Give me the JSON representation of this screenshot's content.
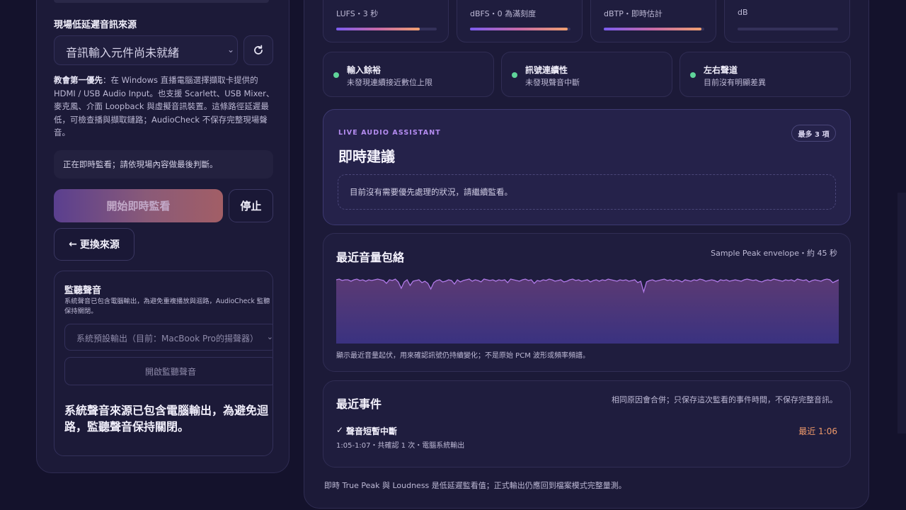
{
  "left": {
    "source_section_title": "現場低延遲音訊來源",
    "source_select_value": "音訊輸入元件尚未就緒",
    "help_bold": "教會第一優先",
    "help_rest": "：在 Windows 直播電腦選擇擷取卡提供的 HDMI / USB Audio Input。也支援 Scarlett、USB Mixer、麥克風、介面 Loopback 與虛擬音訊裝置。這條路徑延遲最低，可檢查播與擷取鏈路；AudioCheck 不保存完整現場聲音。",
    "status_note": "正在即時監看；請依現場內容做最後判斷。",
    "start_button": "開始即時監看",
    "stop_button": "停止",
    "change_source_arrow": "←",
    "change_source_button": "更換來源",
    "monitor": {
      "title": "監聽聲音",
      "description": "系統聲音已包含電腦輸出，為避免重複播放與迴路，AudioCheck 監聽保持關閉。",
      "output_select": "系統預設輸出（目前：MacBook Pro的揚聲器）",
      "open_button": "開啟監聽聲音",
      "note": "系統聲音來源已包含電腦輸出，為避免迴路，監聽聲音保持關閉。"
    }
  },
  "meters": [
    {
      "label": "LUFS・3 秒",
      "fill": 0.83,
      "color": "linear-gradient(90deg,#7b5cf0,#c86aa8,#f0a070)"
    },
    {
      "label": "dBFS・0 為滿刻度",
      "fill": 0.97,
      "color": "linear-gradient(90deg,#7b5cf0,#c86aa8,#f0a070)"
    },
    {
      "label": "dBTP・即時估計",
      "fill": 0.97,
      "color": "linear-gradient(90deg,#7b5cf0,#c86aa8,#f0a070)"
    },
    {
      "label": "dB",
      "fill": 0.0,
      "color": "#34315a"
    }
  ],
  "status": [
    {
      "title": "輸入餘裕",
      "sub": "未發現連續接近數位上限"
    },
    {
      "title": "訊號連續性",
      "sub": "未發現聲音中斷"
    },
    {
      "title": "左右聲道",
      "sub": "目前沒有明顯差異"
    }
  ],
  "assistant": {
    "kicker": "LIVE AUDIO ASSISTANT",
    "title": "即時建議",
    "badge": "最多 3 項",
    "empty": "目前沒有需要優先處理的狀況，請繼續監看。"
  },
  "envelope": {
    "title": "最近音量包絡",
    "meta": "Sample Peak envelope・約 45 秒",
    "caption": "顯示最近音量起伏，用來確認訊號仍持續變化；不是原始 PCM 波形或頻率頻譜。"
  },
  "chart_data": {
    "type": "area",
    "title": "最近音量包絡",
    "ylim": [
      0,
      100
    ],
    "values": [
      90,
      91,
      89,
      90,
      90,
      88,
      90,
      91,
      89,
      90,
      88,
      90,
      89,
      90,
      91,
      90,
      89,
      85,
      90,
      89,
      91,
      87,
      78,
      87,
      90,
      82,
      88,
      89,
      90,
      86,
      88,
      85,
      77,
      86,
      89,
      90,
      87,
      88,
      90,
      89,
      84,
      90,
      87,
      89,
      90,
      91,
      88,
      90,
      89,
      87,
      91,
      90,
      89,
      90,
      88,
      90,
      89,
      90,
      86,
      91,
      90,
      89,
      88,
      90,
      91,
      89,
      90,
      85,
      89,
      88,
      90,
      89,
      91,
      90,
      88,
      89,
      90,
      87,
      88,
      90,
      91,
      89,
      90,
      88,
      89,
      90,
      87,
      89,
      90,
      88,
      90,
      89,
      91,
      90,
      89,
      88,
      90,
      89,
      90,
      88,
      89,
      90,
      86,
      88,
      73,
      87,
      89,
      90,
      88,
      89,
      90,
      91,
      89,
      90,
      88,
      90,
      89,
      87,
      90,
      89,
      88,
      90,
      89,
      91,
      90,
      88,
      89,
      90,
      89,
      87,
      90,
      89,
      90,
      88,
      89,
      90,
      89,
      88,
      90,
      91,
      90,
      89,
      90,
      88,
      87,
      89,
      90,
      89,
      91,
      90,
      89,
      88,
      90,
      89,
      90,
      88,
      91,
      90,
      89,
      90,
      87,
      89,
      90,
      89,
      88,
      90,
      91,
      90,
      86,
      88,
      90
    ]
  },
  "events": {
    "title": "最近事件",
    "note": "相同原因會合併；只保存這次監看的事件時間，不保存完整音訊。",
    "items": [
      {
        "check": "✓",
        "title": "聲音短暫中斷",
        "meta": "1:05-1:07・共確認 1 次・電腦系統輸出",
        "time": "最近 1:06"
      }
    ]
  },
  "footer_note": "即時 True Peak 與 Loudness 是低延遲監看值；正式輸出仍應回到檔案模式完整量測。"
}
